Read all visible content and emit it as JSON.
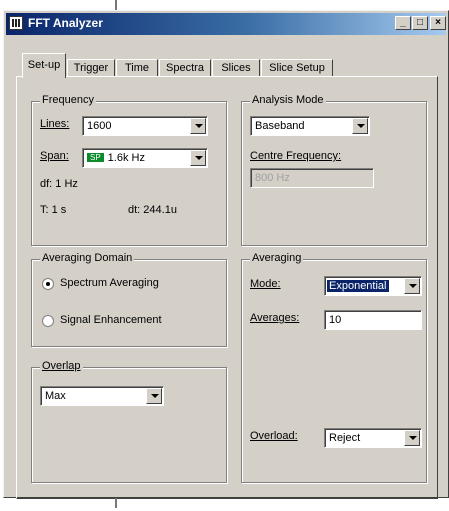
{
  "window": {
    "title": "FFT Analyzer",
    "controls": {
      "minimize": "_",
      "maximize": "□",
      "close": "×"
    }
  },
  "tabs": [
    {
      "label": "Set-up",
      "active": true
    },
    {
      "label": "Trigger"
    },
    {
      "label": "Time"
    },
    {
      "label": "Spectra"
    },
    {
      "label": "Slices"
    },
    {
      "label": "Slice Setup"
    }
  ],
  "frequency": {
    "legend": "Frequency",
    "lines_label": "Lines:",
    "lines_value": "1600",
    "span_label": "Span:",
    "span_badge": "SP",
    "span_value": "1.6k Hz",
    "df": "df: 1 Hz",
    "t": "T: 1 s",
    "dt": "dt: 244.1u"
  },
  "analysis_mode": {
    "legend": "Analysis Mode",
    "mode_value": "Baseband",
    "centre_label": "Centre Frequency:",
    "centre_value": "800 Hz"
  },
  "averaging_domain": {
    "legend": "Averaging Domain",
    "options": [
      "Spectrum Averaging",
      "Signal Enhancement"
    ],
    "selected": "Spectrum Averaging"
  },
  "averaging": {
    "legend": "Averaging",
    "mode_label": "Mode:",
    "mode_value": "Exponential",
    "averages_label": "Averages:",
    "averages_value": "10",
    "overload_label": "Overload:",
    "overload_value": "Reject"
  },
  "overlap": {
    "legend": "Overlap",
    "value": "Max"
  }
}
